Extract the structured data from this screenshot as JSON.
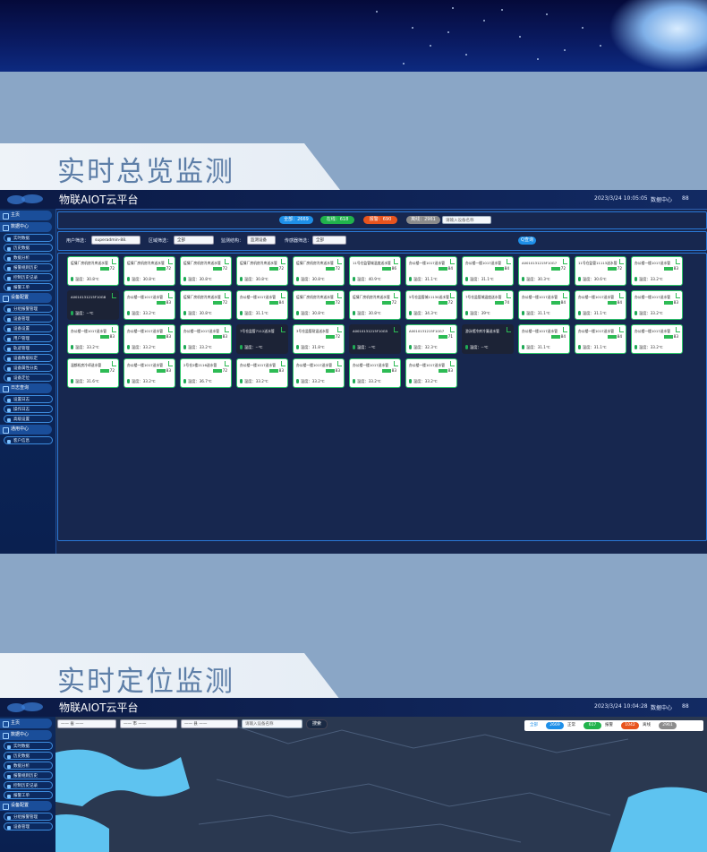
{
  "section1": {
    "title": "实时总览监测"
  },
  "section2": {
    "title": "实时定位监测"
  },
  "app1": {
    "app_title": "物联AIOT云平台",
    "datetime": "2023/3/24 10:05:05",
    "data_center": "数据中心",
    "user": "88",
    "status_pills": [
      {
        "label": "全部：2669",
        "color": "#1e8fe8"
      },
      {
        "label": "在线：618",
        "color": "#21b34c"
      },
      {
        "label": "报警：690",
        "color": "#e8541e"
      },
      {
        "label": "离线：2961",
        "color": "#8c8c8c"
      }
    ],
    "search_placeholder": "请输入设备名称",
    "filters": {
      "user_label": "用户筛选：",
      "user_value": "superadmin-88.",
      "region_label": "区域筛选：",
      "region_value": "全部",
      "monitor_label": "监测结构：",
      "monitor_value": "监测设备",
      "sensor_label": "传感器筛选：",
      "sensor_value": "全部",
      "query_button": "Q查询"
    },
    "cards": [
      {
        "name": "疫情厂房机房冷库送水管",
        "value": "72",
        "temp": "温度：30.8℃"
      },
      {
        "name": "疫情厂房机房冷库送水管",
        "value": "72",
        "temp": "温度：30.8℃"
      },
      {
        "name": "疫情厂房机房冷库送水管",
        "value": "72",
        "temp": "温度：30.8℃"
      },
      {
        "name": "疫情厂房机房冷库送水管",
        "value": "72",
        "temp": "温度：30.8℃"
      },
      {
        "name": "疫情厂房机房冷库送水管",
        "value": "72",
        "temp": "温度：30.8℃"
      },
      {
        "name": "11号仓监管城温度送水管",
        "value": "86",
        "temp": "温度：40.9℃"
      },
      {
        "name": "办公楼一楼1017送水管",
        "value": "84",
        "temp": "温度：31.1℃"
      },
      {
        "name": "办公楼一楼1017送水管",
        "value": "84",
        "temp": "温度：31.1℃"
      },
      {
        "name": "A0010131215F10G7",
        "value": "72",
        "temp": "温度：30.3℃"
      },
      {
        "name": "11号仓监管11113送水管",
        "value": "72",
        "temp": "温度：30.6℃"
      },
      {
        "name": "办公楼一楼1017送水管",
        "value": "83",
        "temp": "温度：33.2℃"
      },
      {
        "name": "A0010131215F10G8",
        "value": "",
        "temp": "温度：--℃",
        "dark": true
      },
      {
        "name": "办公楼一楼1017送水管",
        "value": "83",
        "temp": "温度：33.2℃"
      },
      {
        "name": "疫情厂房机房冷库送水管",
        "value": "72",
        "temp": "温度：30.8℃"
      },
      {
        "name": "办公楼一楼1017送水管",
        "value": "84",
        "temp": "温度：31.1℃"
      },
      {
        "name": "疫情厂房机房冷库送水管",
        "value": "72",
        "temp": "温度：30.8℃"
      },
      {
        "name": "疫情厂房机房冷库送水管",
        "value": "72",
        "temp": "温度：30.8℃"
      },
      {
        "name": "5号仓监管城11130送水管",
        "value": "72",
        "temp": "温度：34.3℃"
      },
      {
        "name": "7号仓监管城温度送水管",
        "value": "74",
        "temp": "温度：39℃"
      },
      {
        "name": "办公楼一楼1017送水管",
        "value": "84",
        "temp": "温度：31.1℃"
      },
      {
        "name": "办公楼一楼1017送水管",
        "value": "84",
        "temp": "温度：31.1℃"
      },
      {
        "name": "办公楼一楼1017送水管",
        "value": "83",
        "temp": "温度：33.2℃"
      },
      {
        "name": "办公楼一楼1017送水管",
        "value": "83",
        "temp": "温度：33.2℃"
      },
      {
        "name": "办公楼一楼1017送水管",
        "value": "83",
        "temp": "温度：33.2℃"
      },
      {
        "name": "办公楼一楼1017送水管",
        "value": "83",
        "temp": "温度：33.2℃"
      },
      {
        "name": "7号仓监管7112送水管",
        "value": "",
        "temp": "温度：--℃",
        "dark": true
      },
      {
        "name": "3号仓监管耐温送水管",
        "value": "72",
        "temp": "温度：31.8℃"
      },
      {
        "name": "A0010131215F10G5",
        "value": "",
        "temp": "温度：--℃",
        "dark": true
      },
      {
        "name": "A0010131215F10G7",
        "value": "71",
        "temp": "温度：32.3℃"
      },
      {
        "name": "游泳馆冷库冷凝送水管",
        "value": "",
        "temp": "温度：--℃",
        "dark": true
      },
      {
        "name": "办公楼一楼1017送水管",
        "value": "84",
        "temp": "温度：31.1℃"
      },
      {
        "name": "办公楼一楼1017送水管",
        "value": "84",
        "temp": "温度：31.1℃"
      },
      {
        "name": "办公楼一楼1017送水管",
        "value": "83",
        "temp": "温度：33.2℃"
      },
      {
        "name": "温都机房冷却送水管",
        "value": "72",
        "temp": "温度：31.6℃"
      },
      {
        "name": "办公楼一楼1017送水管",
        "value": "83",
        "temp": "温度：33.2℃"
      },
      {
        "name": "2号仓2楼2116送水管",
        "value": "72",
        "temp": "温度：36.7℃"
      },
      {
        "name": "办公楼一楼1017送水管",
        "value": "83",
        "temp": "温度：33.2℃"
      },
      {
        "name": "办公楼一楼1017送水管",
        "value": "83",
        "temp": "温度：33.2℃"
      },
      {
        "name": "办公楼一楼1017送水管",
        "value": "83",
        "temp": "温度：33.2℃"
      },
      {
        "name": "办公楼一楼1017送水管",
        "value": "83",
        "temp": "温度：33.2℃"
      }
    ]
  },
  "sidebar": {
    "home": "主页",
    "groups": [
      {
        "label": "数据中心",
        "items": [
          "实时数据",
          "历史数据",
          "数据分析",
          "报警规则历史",
          "控制历史记录",
          "报警工单"
        ]
      },
      {
        "label": "设备配置",
        "items": [
          "分组报警管理",
          "设备管理",
          "设备设置",
          "用户管理",
          "轨迹管理",
          "设备数据标定",
          "设备属性分类",
          "设备定位"
        ]
      },
      {
        "label": "日志查询",
        "items": [
          "设置日志",
          "操作日志",
          "高级设置"
        ]
      },
      {
        "label": "通用中心",
        "items": [
          "客户信息"
        ]
      }
    ]
  },
  "app2": {
    "app_title": "物联AIOT云平台",
    "datetime": "2023/3/24 10:04:28",
    "data_center": "数据中心",
    "user": "88",
    "home": "主页",
    "group1": "数据中心",
    "group1_items": [
      "实时数据",
      "历史数据",
      "数据分析",
      "报警规则历史",
      "控制历史记录",
      "报警工单"
    ],
    "group2": "设备配置",
    "group2_items": [
      "分组报警管理",
      "设备管理"
    ],
    "select1": "—— 省 ——",
    "select2": "—— 市 ——",
    "select3": "—— 县 ——",
    "search_placeholder": "请输入设备名称",
    "search_button": "搜索",
    "legend": [
      {
        "label": "全部",
        "color": "#ffffff",
        "text": "#1e8fe8"
      },
      {
        "label": "2669",
        "color": "#1e8fe8"
      },
      {
        "label": "正常",
        "color": "#ffffff",
        "text": "#333"
      },
      {
        "label": "617",
        "color": "#21b34c"
      },
      {
        "label": "报警",
        "color": "#ffffff",
        "text": "#333"
      },
      {
        "label": "1042",
        "color": "#e8541e"
      },
      {
        "label": "离线",
        "color": "#ffffff",
        "text": "#333"
      },
      {
        "label": "2961",
        "color": "#8c8c8c"
      }
    ]
  }
}
